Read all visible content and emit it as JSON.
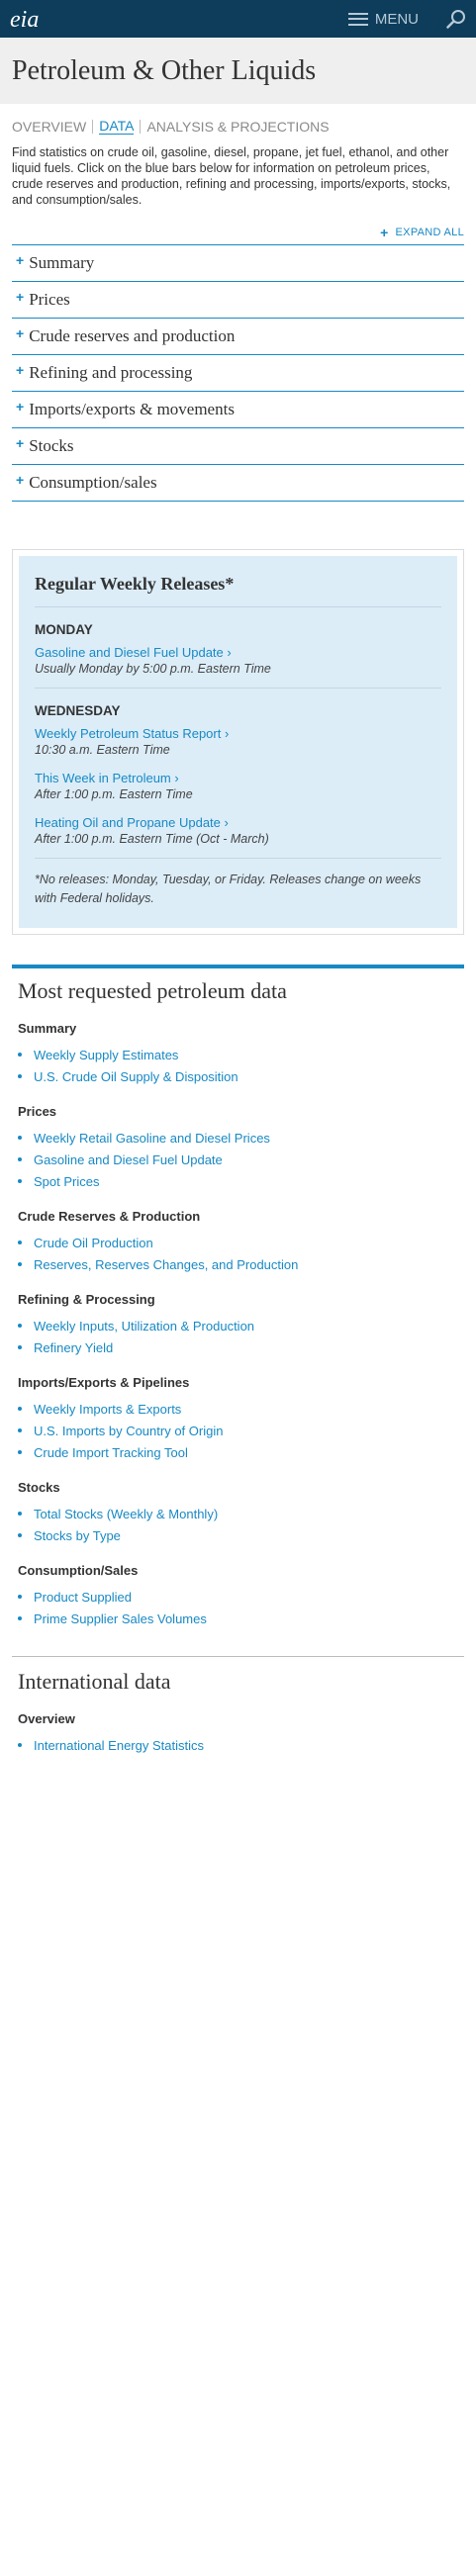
{
  "header": {
    "logo_text": "eia",
    "menu_label": "MENU",
    "colors": {
      "bar": "#0d3d5b",
      "accent": "#1889c4"
    }
  },
  "page": {
    "title": "Petroleum & Other Liquids",
    "tabs": [
      "OVERVIEW",
      "DATA",
      "ANALYSIS & PROJECTIONS"
    ],
    "active_tab": "DATA",
    "intro": "Find statistics on crude oil, gasoline, diesel, propane, jet fuel, ethanol, and other liquid fuels. Click on the blue bars below for information on petroleum prices, crude reserves and production, refining and processing, imports/exports, stocks, and consumption/sales.",
    "expand_all": "EXPAND ALL"
  },
  "accordion": [
    "Summary",
    "Prices",
    "Crude reserves and production",
    "Refining and processing",
    "Imports/exports & movements",
    "Stocks",
    "Consumption/sales"
  ],
  "weekly": {
    "title": "Regular Weekly Releases*",
    "monday": {
      "day": "MONDAY",
      "items": [
        {
          "link": "Gasoline and Diesel Fuel Update ›",
          "time": "Usually Monday by 5:00 p.m. Eastern Time"
        }
      ]
    },
    "wednesday": {
      "day": "WEDNESDAY",
      "items": [
        {
          "link": "Weekly Petroleum Status Report ›",
          "time": "10:30 a.m. Eastern Time"
        },
        {
          "link": "This Week in Petroleum ›",
          "time": "After 1:00 p.m. Eastern Time"
        },
        {
          "link": "Heating Oil and Propane Update ›",
          "time": "After 1:00 p.m. Eastern Time (Oct - March)"
        }
      ]
    },
    "note": "*No releases: Monday, Tuesday, or Friday. Releases change on weeks with Federal holidays."
  },
  "most_requested": {
    "title": "Most requested petroleum data",
    "categories": [
      {
        "name": "Summary",
        "links": [
          "Weekly Supply Estimates",
          "U.S. Crude Oil Supply & Disposition"
        ]
      },
      {
        "name": "Prices",
        "links": [
          "Weekly Retail Gasoline and Diesel Prices",
          "Gasoline and Diesel Fuel Update",
          "Spot Prices"
        ]
      },
      {
        "name": "Crude Reserves & Production",
        "links": [
          "Crude Oil Production",
          "Reserves, Reserves Changes, and Production"
        ]
      },
      {
        "name": "Refining & Processing",
        "links": [
          "Weekly Inputs, Utilization & Production",
          "Refinery Yield"
        ]
      },
      {
        "name": "Imports/Exports & Pipelines",
        "links": [
          "Weekly Imports & Exports",
          "U.S. Imports by Country of Origin",
          "Crude Import Tracking Tool"
        ]
      },
      {
        "name": "Stocks",
        "links": [
          "Total Stocks (Weekly & Monthly)",
          "Stocks by Type"
        ]
      },
      {
        "name": "Consumption/Sales",
        "links": [
          "Product Supplied",
          "Prime Supplier Sales Volumes"
        ]
      }
    ]
  },
  "international": {
    "title": "International data",
    "categories": [
      {
        "name": "Overview",
        "links": [
          "International Energy Statistics"
        ]
      }
    ]
  }
}
